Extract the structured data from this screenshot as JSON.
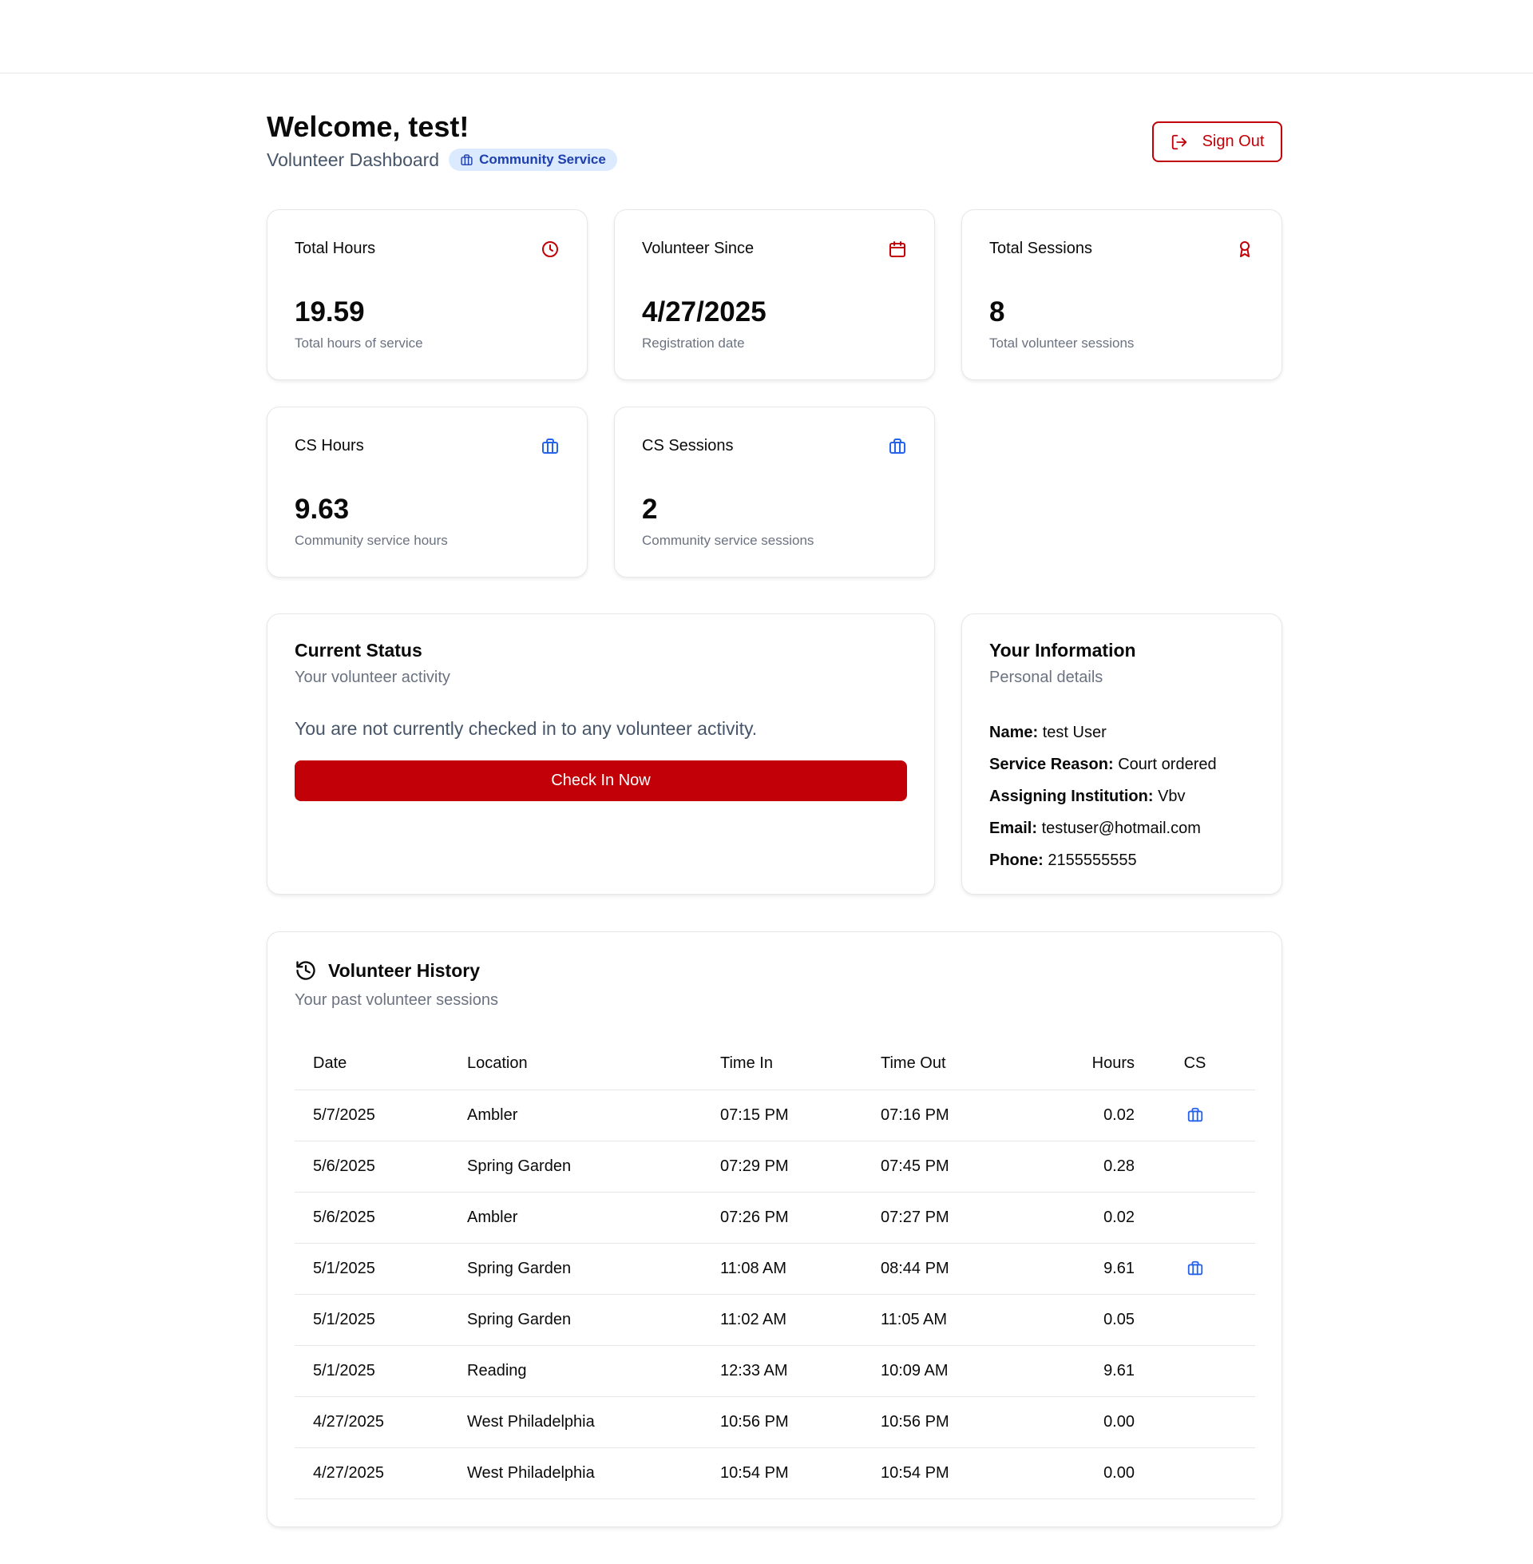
{
  "header": {
    "welcome": "Welcome, test!",
    "subtitle": "Volunteer Dashboard",
    "badge": "Community Service",
    "sign_out": "Sign Out"
  },
  "colors": {
    "primary": "#c20007",
    "accent_blue": "#2563eb",
    "badge_bg": "#dbeafe"
  },
  "stats": [
    {
      "label": "Total Hours",
      "icon": "clock-icon",
      "value": "19.59",
      "caption": "Total hours of service"
    },
    {
      "label": "Volunteer Since",
      "icon": "calendar-icon",
      "value": "4/27/2025",
      "caption": "Registration date"
    },
    {
      "label": "Total Sessions",
      "icon": "award-icon",
      "value": "8",
      "caption": "Total volunteer sessions"
    },
    {
      "label": "CS Hours",
      "icon": "briefcase-icon",
      "value": "9.63",
      "caption": "Community service hours"
    },
    {
      "label": "CS Sessions",
      "icon": "briefcase-icon",
      "value": "2",
      "caption": "Community service sessions"
    }
  ],
  "status": {
    "title": "Current Status",
    "subtitle": "Your volunteer activity",
    "message": "You are not currently checked in to any volunteer activity.",
    "button": "Check In Now"
  },
  "info": {
    "title": "Your Information",
    "subtitle": "Personal details",
    "fields": [
      {
        "label": "Name:",
        "value": "test User"
      },
      {
        "label": "Service Reason:",
        "value": "Court ordered"
      },
      {
        "label": "Assigning Institution:",
        "value": "Vbv"
      },
      {
        "label": "Email:",
        "value": "testuser@hotmail.com"
      },
      {
        "label": "Phone:",
        "value": "2155555555"
      }
    ]
  },
  "history": {
    "title": "Volunteer History",
    "subtitle": "Your past volunteer sessions",
    "columns": [
      "Date",
      "Location",
      "Time In",
      "Time Out",
      "Hours",
      "CS"
    ],
    "rows": [
      {
        "date": "5/7/2025",
        "location": "Ambler",
        "time_in": "07:15 PM",
        "time_out": "07:16 PM",
        "hours": "0.02",
        "cs": true
      },
      {
        "date": "5/6/2025",
        "location": "Spring Garden",
        "time_in": "07:29 PM",
        "time_out": "07:45 PM",
        "hours": "0.28",
        "cs": false
      },
      {
        "date": "5/6/2025",
        "location": "Ambler",
        "time_in": "07:26 PM",
        "time_out": "07:27 PM",
        "hours": "0.02",
        "cs": false
      },
      {
        "date": "5/1/2025",
        "location": "Spring Garden",
        "time_in": "11:08 AM",
        "time_out": "08:44 PM",
        "hours": "9.61",
        "cs": true
      },
      {
        "date": "5/1/2025",
        "location": "Spring Garden",
        "time_in": "11:02 AM",
        "time_out": "11:05 AM",
        "hours": "0.05",
        "cs": false
      },
      {
        "date": "5/1/2025",
        "location": "Reading",
        "time_in": "12:33 AM",
        "time_out": "10:09 AM",
        "hours": "9.61",
        "cs": false
      },
      {
        "date": "4/27/2025",
        "location": "West Philadelphia",
        "time_in": "10:56 PM",
        "time_out": "10:56 PM",
        "hours": "0.00",
        "cs": false
      },
      {
        "date": "4/27/2025",
        "location": "West Philadelphia",
        "time_in": "10:54 PM",
        "time_out": "10:54 PM",
        "hours": "0.00",
        "cs": false
      }
    ]
  }
}
